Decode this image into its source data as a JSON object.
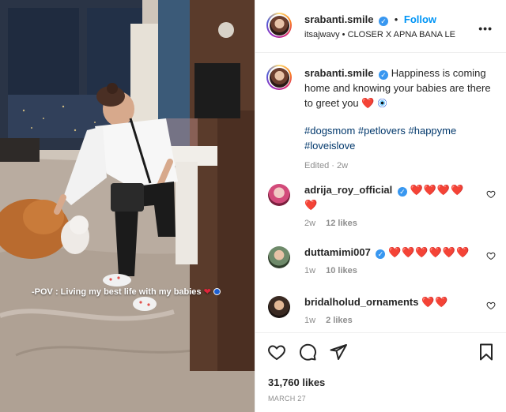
{
  "post": {
    "author": "srabanti.smile",
    "follow_label": "Follow",
    "audio": "itsajwavy • CLOSER X APNA BANA LE",
    "caption": "Happiness is coming home and knowing your babies are there to greet you",
    "hashtags_line1": "#dogsmom #petlovers #happyme",
    "hashtags_line2": "#loveislove",
    "edited": "Edited",
    "edited_time": "2w",
    "likes": "31,760 likes",
    "date": "MARCH 27",
    "overlay_text": "-POV : Living my best life with my babies"
  },
  "comments": [
    {
      "user": "adrija_roy_official",
      "hearts_line1": "❤️❤️❤️❤️",
      "hearts_line2": "❤️",
      "time": "2w",
      "likes": "12 likes"
    },
    {
      "user": "duttamimi007",
      "hearts_line1": "❤️❤️❤️❤️❤️❤️",
      "time": "1w",
      "likes": "10 likes"
    },
    {
      "user": "bridalholud_ornaments",
      "hearts_line1": "❤️❤️",
      "time": "1w",
      "likes": "2 likes"
    }
  ],
  "icons": {
    "like": "heart-icon",
    "comment": "comment-icon",
    "share": "send-icon",
    "save": "bookmark-icon",
    "more": "more-options-icon"
  },
  "colors": {
    "accent": "#0095f6",
    "verified": "#3897f0",
    "heart": "#e0243a",
    "hashtag": "#00376b"
  }
}
